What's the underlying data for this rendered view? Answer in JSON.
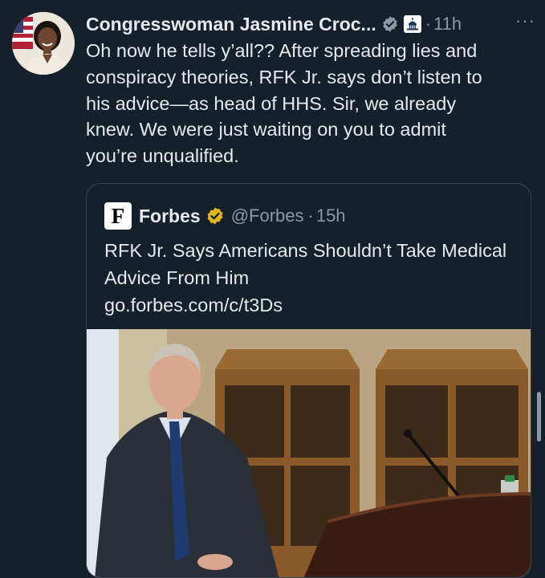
{
  "tweet": {
    "author_name": "Congresswoman Jasmine Croc...",
    "separator": "·",
    "time": "11h",
    "more_label": "···",
    "text": "Oh now he tells y’all?? After spreading lies and\nconspiracy theories, RFK Jr. says don’t listen to\nhis advice—as head of HHS. Sir, we already\nknew. We were just waiting on you to admit\nyou’re unqualified."
  },
  "quote": {
    "logo_letter": "F",
    "author_name": "Forbes",
    "handle": "@Forbes",
    "separator": "·",
    "time": "15h",
    "headline": "RFK Jr. Says Americans Shouldn’t Take Medical Advice From Him",
    "link": "go.forbes.com/c/t3Ds"
  },
  "colors": {
    "background": "#15202b",
    "text": "#e7e9ea",
    "muted": "#8b98a5",
    "border": "#38444d",
    "verified_blue_gray": "#8b98a5",
    "verified_gold": "#e2b719"
  },
  "icons": {
    "verified": "verified-badge-icon",
    "government": "capitol-building-icon",
    "gold_verified": "gold-verified-badge-icon",
    "more": "more-options-icon"
  }
}
